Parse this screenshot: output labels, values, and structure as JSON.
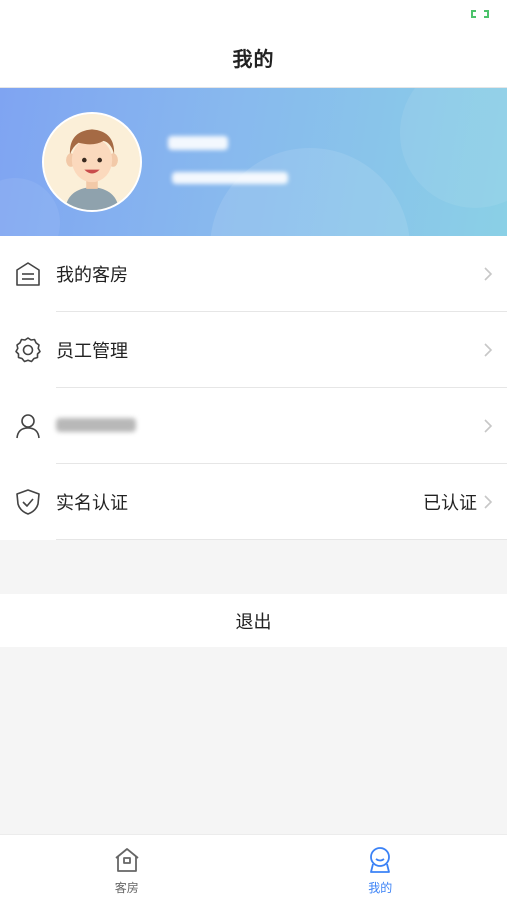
{
  "header": {
    "title": "我的"
  },
  "status_bar": {
    "icon": "battery-charging-icon"
  },
  "profile": {
    "avatar_icon": "avatar-cartoon-boy",
    "name": "",
    "phone": ""
  },
  "menu": [
    {
      "id": "my-rooms",
      "label": "我的客房",
      "value": "",
      "icon": "room-list-icon"
    },
    {
      "id": "staff-management",
      "label": "员工管理",
      "value": "",
      "icon": "gear-icon"
    },
    {
      "id": "personal",
      "label": "",
      "value": "",
      "icon": "user-icon"
    },
    {
      "id": "real-name",
      "label": "实名认证",
      "value": "已认证",
      "icon": "shield-check-icon"
    }
  ],
  "logout": {
    "label": "退出"
  },
  "tabs": [
    {
      "label": "客房",
      "icon": "house-icon",
      "active": false
    },
    {
      "label": "我的",
      "icon": "person-icon",
      "active": true
    }
  ],
  "colors": {
    "accent": "#3b82f6",
    "banner_start": "#7fa4f2",
    "banner_end": "#8ad0e6"
  }
}
